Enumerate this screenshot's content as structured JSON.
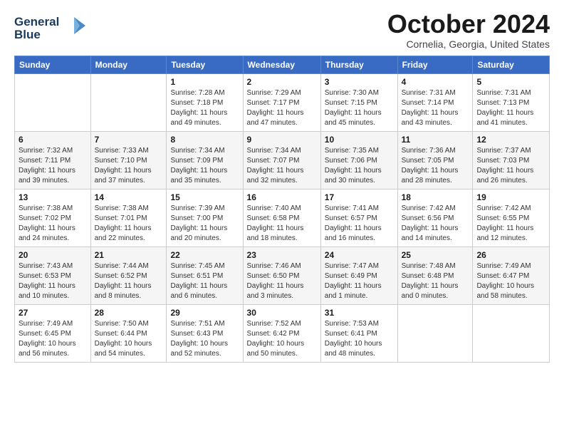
{
  "header": {
    "logo_line1": "General",
    "logo_line2": "Blue",
    "month_title": "October 2024",
    "location": "Cornelia, Georgia, United States"
  },
  "weekdays": [
    "Sunday",
    "Monday",
    "Tuesday",
    "Wednesday",
    "Thursday",
    "Friday",
    "Saturday"
  ],
  "weeks": [
    [
      {
        "day": "",
        "info": ""
      },
      {
        "day": "",
        "info": ""
      },
      {
        "day": "1",
        "info": "Sunrise: 7:28 AM\nSunset: 7:18 PM\nDaylight: 11 hours\nand 49 minutes."
      },
      {
        "day": "2",
        "info": "Sunrise: 7:29 AM\nSunset: 7:17 PM\nDaylight: 11 hours\nand 47 minutes."
      },
      {
        "day": "3",
        "info": "Sunrise: 7:30 AM\nSunset: 7:15 PM\nDaylight: 11 hours\nand 45 minutes."
      },
      {
        "day": "4",
        "info": "Sunrise: 7:31 AM\nSunset: 7:14 PM\nDaylight: 11 hours\nand 43 minutes."
      },
      {
        "day": "5",
        "info": "Sunrise: 7:31 AM\nSunset: 7:13 PM\nDaylight: 11 hours\nand 41 minutes."
      }
    ],
    [
      {
        "day": "6",
        "info": "Sunrise: 7:32 AM\nSunset: 7:11 PM\nDaylight: 11 hours\nand 39 minutes."
      },
      {
        "day": "7",
        "info": "Sunrise: 7:33 AM\nSunset: 7:10 PM\nDaylight: 11 hours\nand 37 minutes."
      },
      {
        "day": "8",
        "info": "Sunrise: 7:34 AM\nSunset: 7:09 PM\nDaylight: 11 hours\nand 35 minutes."
      },
      {
        "day": "9",
        "info": "Sunrise: 7:34 AM\nSunset: 7:07 PM\nDaylight: 11 hours\nand 32 minutes."
      },
      {
        "day": "10",
        "info": "Sunrise: 7:35 AM\nSunset: 7:06 PM\nDaylight: 11 hours\nand 30 minutes."
      },
      {
        "day": "11",
        "info": "Sunrise: 7:36 AM\nSunset: 7:05 PM\nDaylight: 11 hours\nand 28 minutes."
      },
      {
        "day": "12",
        "info": "Sunrise: 7:37 AM\nSunset: 7:03 PM\nDaylight: 11 hours\nand 26 minutes."
      }
    ],
    [
      {
        "day": "13",
        "info": "Sunrise: 7:38 AM\nSunset: 7:02 PM\nDaylight: 11 hours\nand 24 minutes."
      },
      {
        "day": "14",
        "info": "Sunrise: 7:38 AM\nSunset: 7:01 PM\nDaylight: 11 hours\nand 22 minutes."
      },
      {
        "day": "15",
        "info": "Sunrise: 7:39 AM\nSunset: 7:00 PM\nDaylight: 11 hours\nand 20 minutes."
      },
      {
        "day": "16",
        "info": "Sunrise: 7:40 AM\nSunset: 6:58 PM\nDaylight: 11 hours\nand 18 minutes."
      },
      {
        "day": "17",
        "info": "Sunrise: 7:41 AM\nSunset: 6:57 PM\nDaylight: 11 hours\nand 16 minutes."
      },
      {
        "day": "18",
        "info": "Sunrise: 7:42 AM\nSunset: 6:56 PM\nDaylight: 11 hours\nand 14 minutes."
      },
      {
        "day": "19",
        "info": "Sunrise: 7:42 AM\nSunset: 6:55 PM\nDaylight: 11 hours\nand 12 minutes."
      }
    ],
    [
      {
        "day": "20",
        "info": "Sunrise: 7:43 AM\nSunset: 6:53 PM\nDaylight: 11 hours\nand 10 minutes."
      },
      {
        "day": "21",
        "info": "Sunrise: 7:44 AM\nSunset: 6:52 PM\nDaylight: 11 hours\nand 8 minutes."
      },
      {
        "day": "22",
        "info": "Sunrise: 7:45 AM\nSunset: 6:51 PM\nDaylight: 11 hours\nand 6 minutes."
      },
      {
        "day": "23",
        "info": "Sunrise: 7:46 AM\nSunset: 6:50 PM\nDaylight: 11 hours\nand 3 minutes."
      },
      {
        "day": "24",
        "info": "Sunrise: 7:47 AM\nSunset: 6:49 PM\nDaylight: 11 hours\nand 1 minute."
      },
      {
        "day": "25",
        "info": "Sunrise: 7:48 AM\nSunset: 6:48 PM\nDaylight: 11 hours\nand 0 minutes."
      },
      {
        "day": "26",
        "info": "Sunrise: 7:49 AM\nSunset: 6:47 PM\nDaylight: 10 hours\nand 58 minutes."
      }
    ],
    [
      {
        "day": "27",
        "info": "Sunrise: 7:49 AM\nSunset: 6:45 PM\nDaylight: 10 hours\nand 56 minutes."
      },
      {
        "day": "28",
        "info": "Sunrise: 7:50 AM\nSunset: 6:44 PM\nDaylight: 10 hours\nand 54 minutes."
      },
      {
        "day": "29",
        "info": "Sunrise: 7:51 AM\nSunset: 6:43 PM\nDaylight: 10 hours\nand 52 minutes."
      },
      {
        "day": "30",
        "info": "Sunrise: 7:52 AM\nSunset: 6:42 PM\nDaylight: 10 hours\nand 50 minutes."
      },
      {
        "day": "31",
        "info": "Sunrise: 7:53 AM\nSunset: 6:41 PM\nDaylight: 10 hours\nand 48 minutes."
      },
      {
        "day": "",
        "info": ""
      },
      {
        "day": "",
        "info": ""
      }
    ]
  ]
}
